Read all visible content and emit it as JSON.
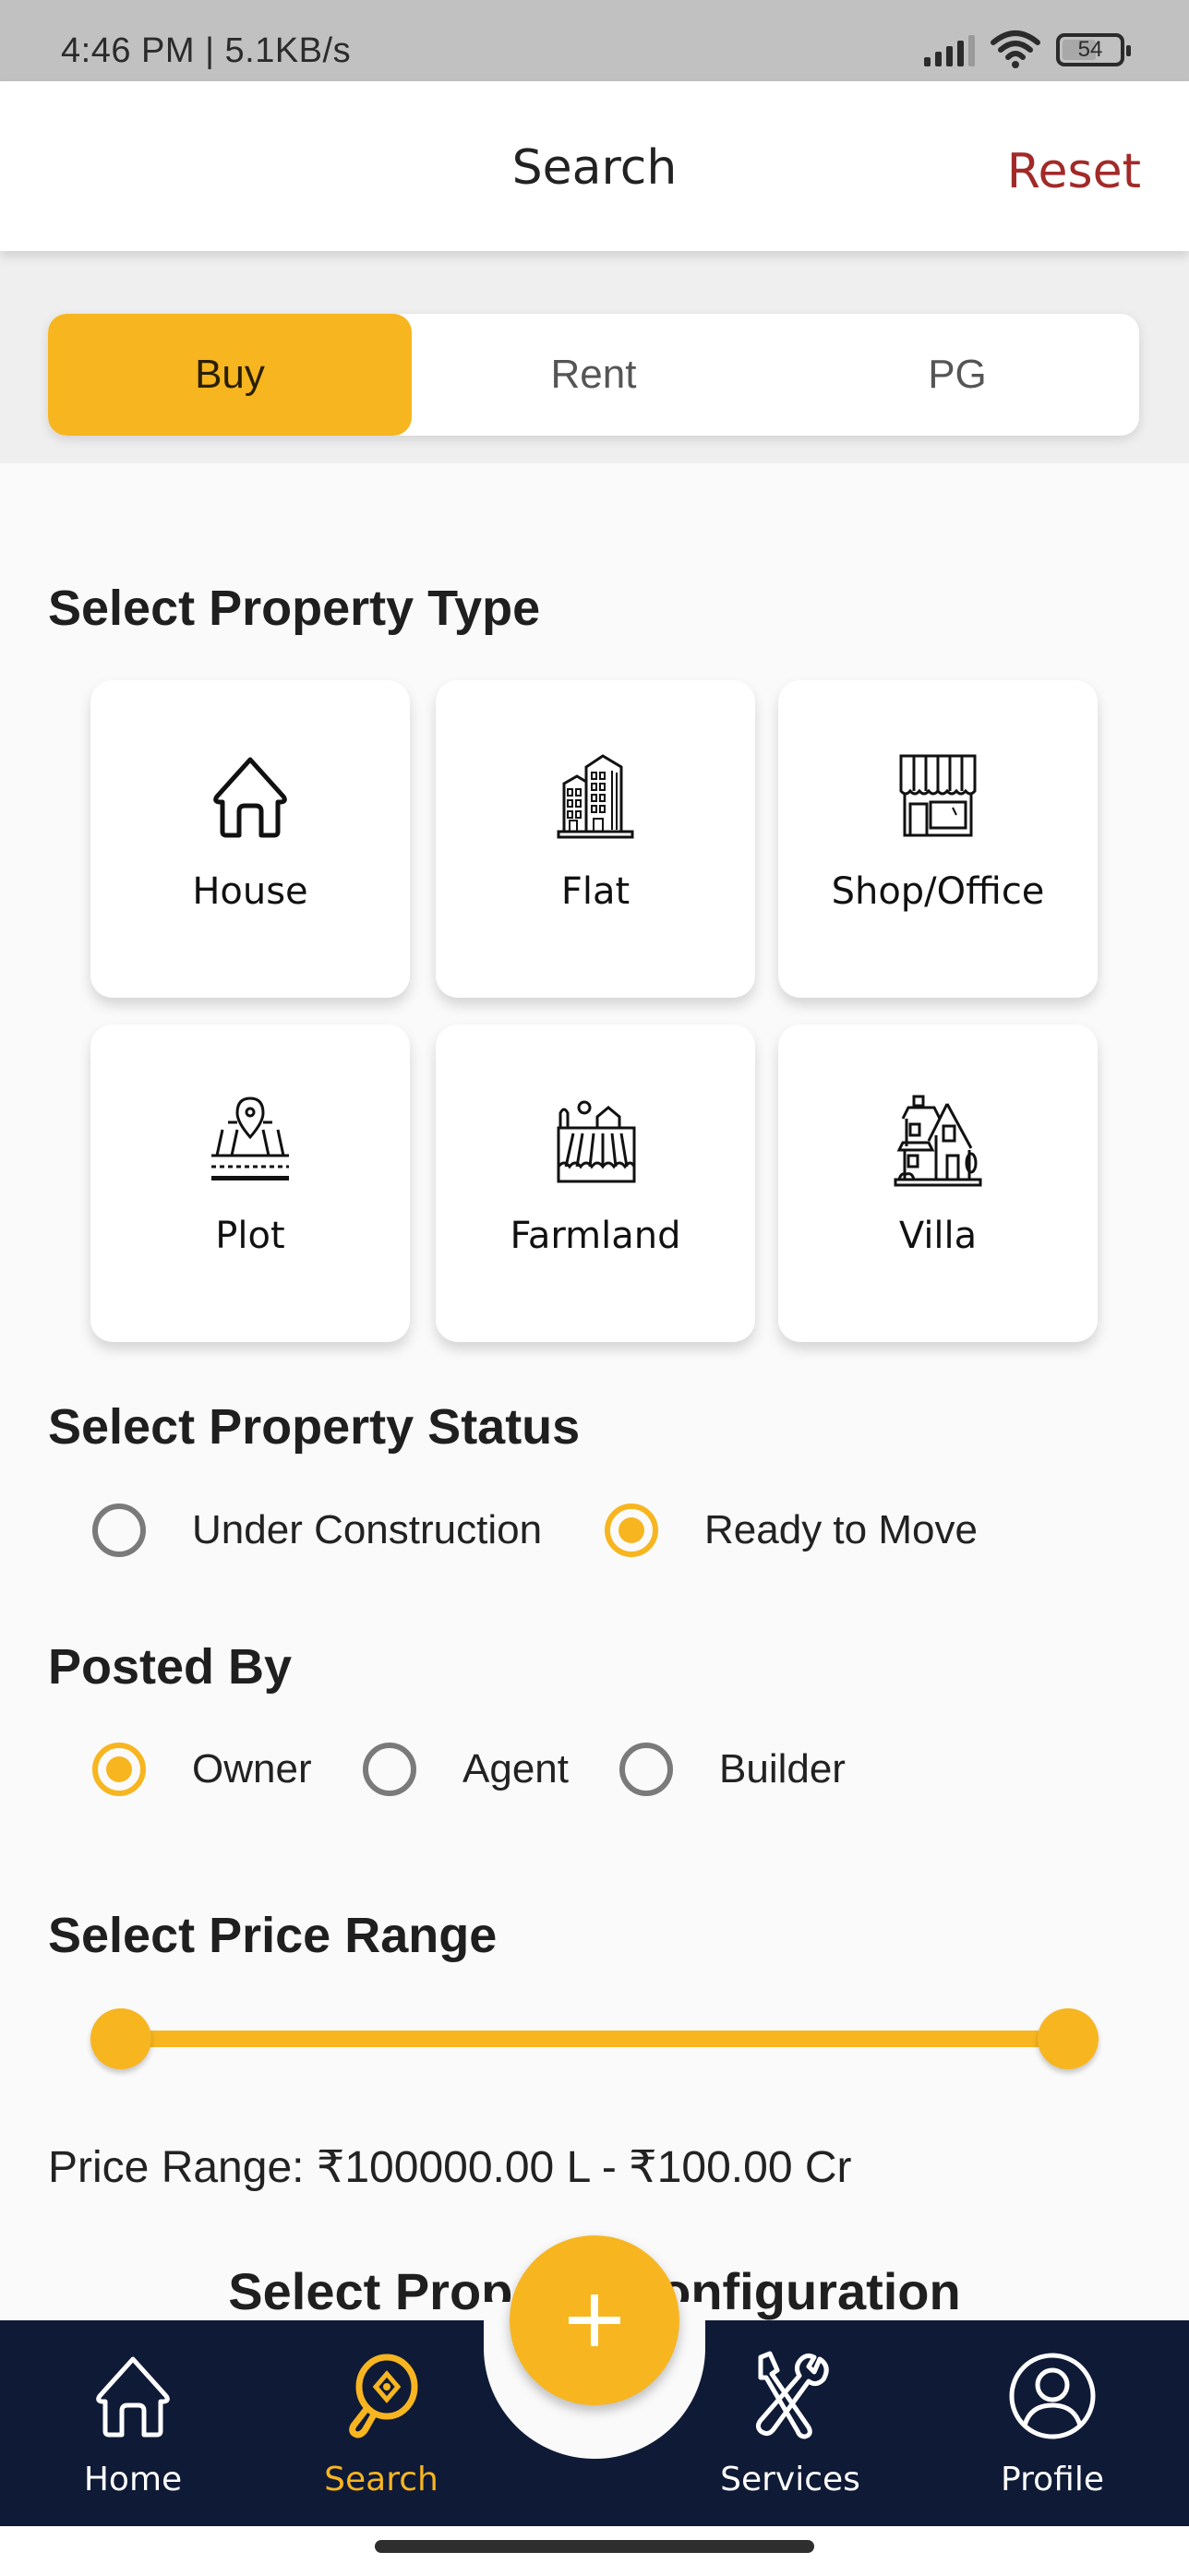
{
  "status_bar": {
    "time_speed": "4:46 PM | 5.1KB/s",
    "battery": "54",
    "icons": [
      "signal-icon",
      "wifi-icon",
      "battery-icon"
    ]
  },
  "header": {
    "title": "Search",
    "reset_label": "Reset"
  },
  "tabs": [
    {
      "label": "Buy",
      "active": true
    },
    {
      "label": "Rent",
      "active": false
    },
    {
      "label": "PG",
      "active": false
    }
  ],
  "property_type": {
    "title": "Select Property Type",
    "items": [
      {
        "label": "House",
        "icon": "house-icon"
      },
      {
        "label": "Flat",
        "icon": "building-icon"
      },
      {
        "label": "Shop/Office",
        "icon": "shop-icon"
      },
      {
        "label": "Plot",
        "icon": "plot-icon"
      },
      {
        "label": "Farmland",
        "icon": "farmland-icon"
      },
      {
        "label": "Villa",
        "icon": "villa-icon"
      }
    ]
  },
  "property_status": {
    "title": "Select Property Status",
    "options": [
      {
        "label": "Under Construction",
        "checked": false
      },
      {
        "label": "Ready to Move",
        "checked": true
      }
    ]
  },
  "posted_by": {
    "title": "Posted By",
    "options": [
      {
        "label": "Owner",
        "checked": true
      },
      {
        "label": "Agent",
        "checked": false
      },
      {
        "label": "Builder",
        "checked": false
      }
    ]
  },
  "price_range": {
    "title": "Select Price Range",
    "slider_min_fraction": 0.0,
    "slider_max_fraction": 1.0,
    "text": "Price Range: ₹100000.00 L - ₹100.00 Cr"
  },
  "configuration": {
    "title": "Select Property Configuration"
  },
  "bottom_nav": {
    "items": [
      {
        "label": "Home",
        "icon": "home-icon",
        "active": false
      },
      {
        "label": "Search",
        "icon": "search-icon",
        "active": true
      },
      {
        "label": "Services",
        "icon": "tools-icon",
        "active": false
      },
      {
        "label": "Profile",
        "icon": "profile-icon",
        "active": false
      }
    ],
    "fab_icon": "plus-icon"
  },
  "colors": {
    "accent": "#f7b520",
    "reset": "#a12a28",
    "nav_bg": "#0f1a36"
  }
}
